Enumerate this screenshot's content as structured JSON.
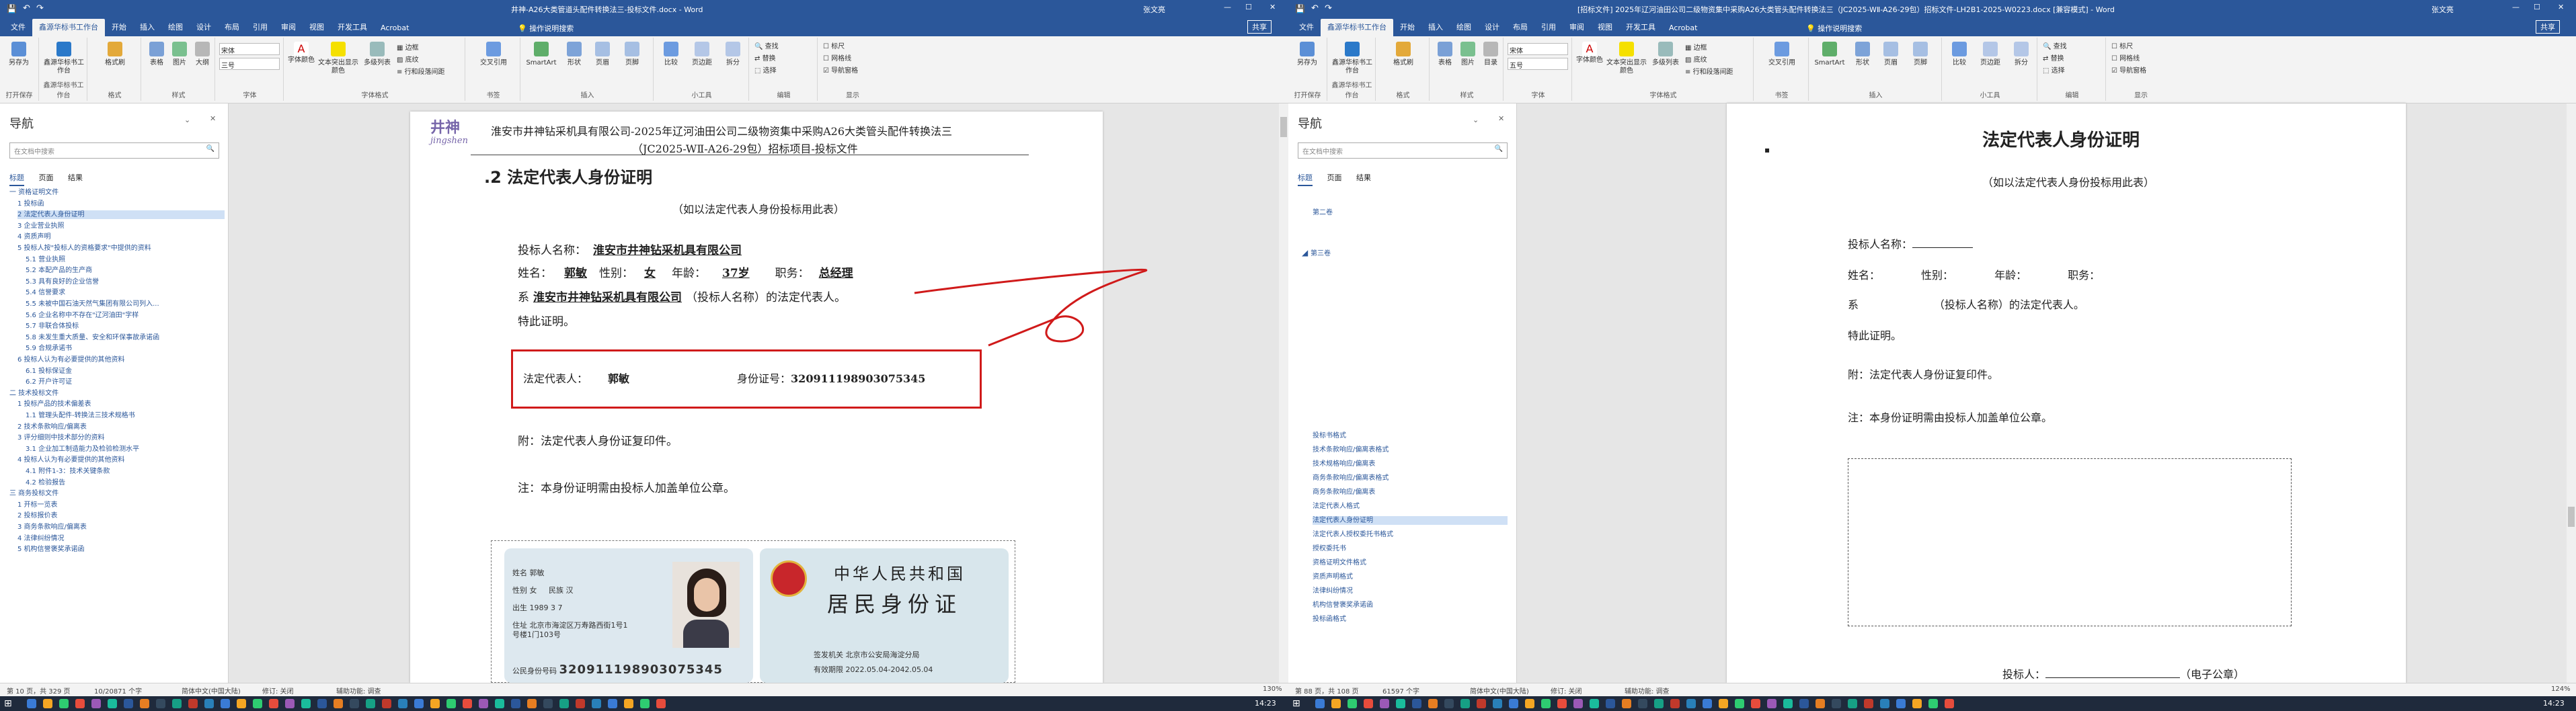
{
  "left": {
    "titlebar": {
      "title": "井神-A26大类管道头配件转换法三-投标文件.docx - Word",
      "user": "张文亮",
      "share": "共享"
    },
    "tabs": [
      "文件",
      "鑫源华标书工作台",
      "开始",
      "插入",
      "绘图",
      "设计",
      "布局",
      "引用",
      "审阅",
      "视图",
      "开发工具",
      "Acrobat"
    ],
    "active_tab": "鑫源华标书工作台",
    "tell_me": "操作说明搜索",
    "ribbon": {
      "font_name": "宋体",
      "font_size": "三号",
      "groups": [
        "打开保存",
        "鑫源华标书工作台",
        "格式",
        "样式",
        "字体",
        "字体格式",
        "书签",
        "插入",
        "小工具",
        "编辑",
        "显示"
      ],
      "buttons": [
        "另存为",
        "鑫源华标书工作台",
        "格式刷",
        "表格",
        "图片",
        "大纲",
        "目录",
        "字体颜色",
        "文本突出显示颜色",
        "多级列表",
        "边框",
        "底纹",
        "行和段落间距",
        "交叉引用",
        "SmartArt",
        "形状",
        "页眉",
        "页脚",
        "比较",
        "页边距",
        "拆分",
        "查找",
        "替换",
        "选择",
        "标尺",
        "网格线",
        "导航窗格"
      ]
    },
    "nav": {
      "title": "导航",
      "search_placeholder": "在文档中搜索",
      "tabs": [
        "标题",
        "页面",
        "结果"
      ],
      "items": [
        "一 资格证明文件",
        "1 投标函",
        "2 法定代表人身份证明",
        "3 企业营业执照",
        "4 资质声明",
        "5 投标人按\"投标人的资格要求\"中提供的资料",
        "5.1 营业执照",
        "5.2 本配产品的生产商",
        "5.3 具有良好的企业信誉",
        "5.4 信誉要求",
        "5.5 未被中国石油天然气集团有限公司列入...",
        "5.6 企业名称中不存在\"辽河油田\"字样",
        "5.7 非联合体投标",
        "5.8 未发生重大质量、安全和环保事故承诺函",
        "5.9 合规承诺书",
        "6 投标人认为有必要提供的其他资料",
        "6.1 投标保证金",
        "6.2 开户许可证",
        "二 技术投标文件",
        "1 投标产品的技术偏差表",
        "1.1 管理头配件-转换法三技术规格书",
        "2 技术条款响应/偏离表",
        "3 评分细则中技术部分的资料",
        "3.1 企业加工制造能力及检验检测水平",
        "4 投标人认为有必要提供的其他资料",
        "4.1 附件1-3：技术关键条款",
        "4.2 检验报告",
        "三 商务投标文件",
        "1 开标一览表",
        "2 投标报价表",
        "3 商务条款响应/偏离表",
        "4 法律纠纷情况",
        "5 机构信誉褒奖承诺函"
      ]
    },
    "doc": {
      "logo_text": "井神",
      "logo_sub": "jingshen",
      "header_line1": "淮安市井神钻采机具有限公司-2025年辽河油田公司二级物资集中采购A26大类管头配件转换法三",
      "header_line2": "（JC2025-WⅡ-A26-29包）招标项目-投标文件",
      "heading": ".2 法定代表人身份证明",
      "subtitle": "（如以法定代表人身份投标用此表）",
      "bidder_label": "投标人名称：",
      "bidder_name": "淮安市井神钻采机具有限公司",
      "name_label": "姓名：",
      "name": "郭敏",
      "gender_label": "性别：",
      "gender": "女",
      "age_label": "年龄：",
      "age": "37岁",
      "duty_label": "职务：",
      "duty": "总经理",
      "line_xi": "系",
      "company": "淮安市井神钻采机具有限公司",
      "line_xi_tail": "（投标人名称）的法定代表人。",
      "special": "特此证明。",
      "rep_label": "法定代表人：",
      "rep_name": "郭敏",
      "id_label": "身份证号：",
      "id_number": "320911198903075345",
      "attach": "附：法定代表人身份证复印件。",
      "note": "注：本身份证明需由投标人加盖单位公章。",
      "id_front": {
        "name_label": "姓名",
        "name": "郭敏",
        "gender_label": "性别",
        "gender": "女",
        "nation_label": "民族",
        "nation": "汉",
        "birth_label": "出生",
        "birth": "1989 3 7",
        "addr_label": "住址",
        "addr": "北京市海淀区万寿路西街1号1号楼1门103号",
        "idno_label": "公民身份号码",
        "idno": "320911198903075345"
      },
      "id_back": {
        "title1": "中华人民共和国",
        "title2": "居民身份证",
        "authority_label": "签发机关",
        "authority": "北京市公安局海淀分局",
        "valid_label": "有效期限",
        "valid": "2022.05.04-2042.05.04"
      }
    },
    "status": {
      "page": "第 10 页，共 329 页",
      "words": "10/20871 个字",
      "lang": "简体中文(中国大陆)",
      "track": "修订: 关闭",
      "accessibility": "辅助功能: 调查"
    }
  },
  "right": {
    "titlebar": {
      "title": "[招标文件] 2025年辽河油田公司二级物资集中采购A26大类管头配件转换法三（JC2025-WⅡ-A26-29包）招标文件-LH2B1-2025-W0223.docx [兼容模式] - Word",
      "user": "张文亮",
      "share": "共享"
    },
    "tabs": [
      "文件",
      "鑫源华标书工作台",
      "开始",
      "插入",
      "绘图",
      "设计",
      "布局",
      "引用",
      "审阅",
      "视图",
      "开发工具",
      "Acrobat"
    ],
    "active_tab": "鑫源华标书工作台",
    "tell_me": "操作说明搜索",
    "ribbon": {
      "font_name": "宋体",
      "font_size": "五号"
    },
    "nav": {
      "title": "导航",
      "search_placeholder": "在文档中搜索",
      "tabs": [
        "标题",
        "页面",
        "结果"
      ],
      "items_top": [
        "第二卷",
        "第三卷"
      ],
      "items": [
        "投标书格式",
        "技术条款响应/偏离表格式",
        "技术规格响应/偏离表",
        "商务条款响应/偏离表格式",
        "商务条款响应/偏离表",
        "法定代表人格式",
        "法定代表人身份证明",
        "法定代表人授权委托书格式",
        "授权委托书",
        "资格证明文件格式",
        "资质声明格式",
        "法律纠纷情况",
        "机构信誉褒奖承诺函",
        "投标函格式"
      ],
      "selected": "法定代表人身份证明"
    },
    "doc": {
      "heading": "法定代表人身份证明",
      "subtitle": "（如以法定代表人身份投标用此表）",
      "bidder": "投标人名称：",
      "name_line": "姓名：            性别：            年龄：            职务：",
      "xi_line": "系                      （投标人名称）的法定代表人。",
      "special": "特此证明。",
      "attach": "附：法定代表人身份证复印件。",
      "note": "注：本身份证明需由投标人加盖单位公章。",
      "sign": "投标人：",
      "sign_tail": "（电子公章）"
    },
    "status": {
      "page": "第 88 页，共 108 页",
      "words": "61597 个字",
      "lang": "简体中文(中国大陆)",
      "track": "修订: 关闭",
      "accessibility": "辅助功能: 调查",
      "zoom": "124%"
    }
  },
  "status_left_zoom": "130%",
  "taskbar": {
    "time_left": "14:23",
    "time_right": "14:23"
  },
  "colors": {
    "word_blue": "#2b579a",
    "annot_red": "#d01a1a"
  }
}
